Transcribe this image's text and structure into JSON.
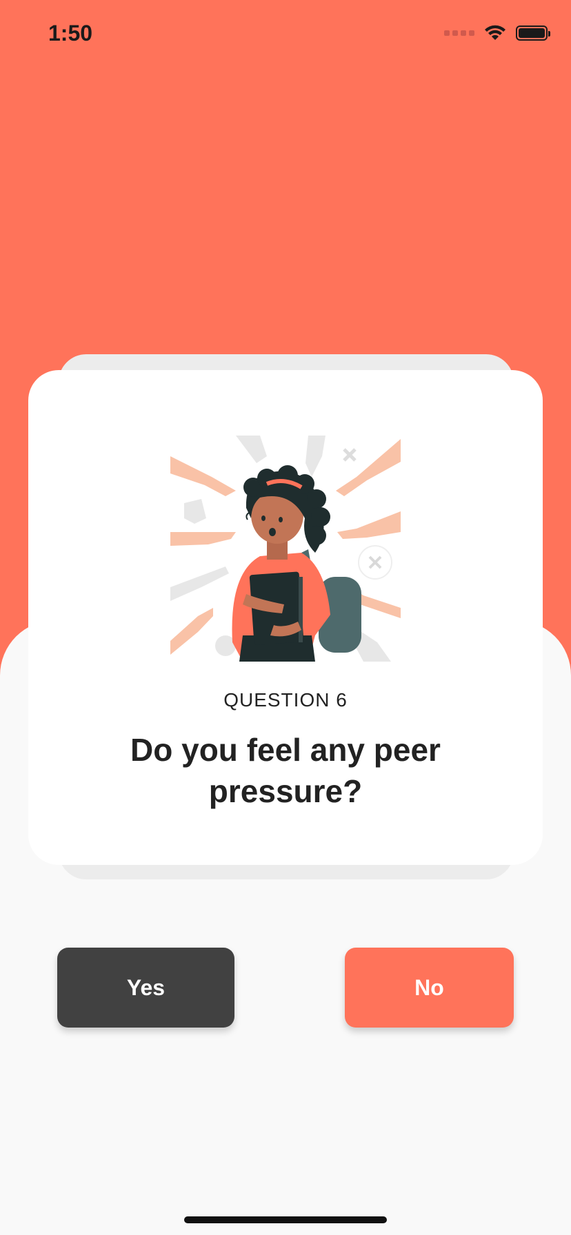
{
  "status_bar": {
    "time": "1:50"
  },
  "question": {
    "label": "QUESTION 6",
    "text": "Do you feel any peer pressure?"
  },
  "buttons": {
    "yes": "Yes",
    "no": "No"
  },
  "colors": {
    "accent": "#ff735a",
    "yes_button": "#414141",
    "background": "#f9f9f9"
  },
  "illustration": {
    "icon": "peer-pressure-girl-illustration"
  }
}
